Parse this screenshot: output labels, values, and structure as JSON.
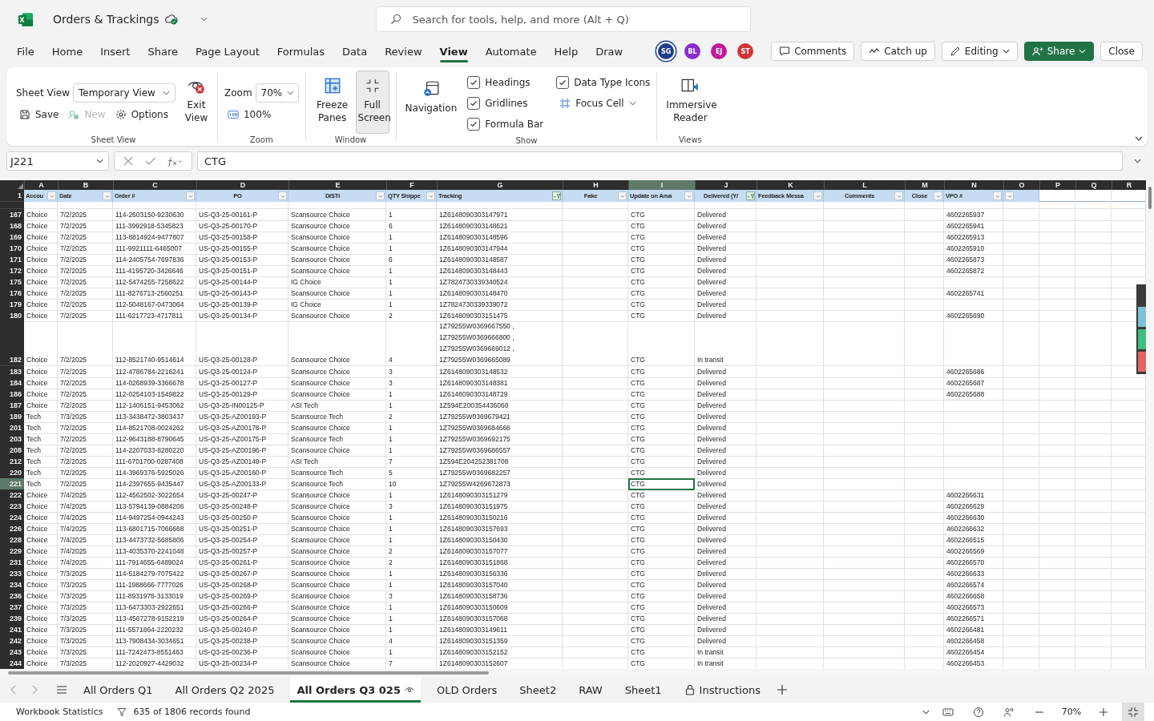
{
  "app": {
    "title": "Orders & Trackings",
    "search": {
      "placeholder": "Search for tools, help, and more (Alt + Q)"
    }
  },
  "menu": [
    {
      "label": "File",
      "selected": false
    },
    {
      "label": "Home",
      "selected": false
    },
    {
      "label": "Insert",
      "selected": false
    },
    {
      "label": "Share",
      "selected": false
    },
    {
      "label": "Page Layout",
      "selected": false
    },
    {
      "label": "Formulas",
      "selected": false
    },
    {
      "label": "Data",
      "selected": false
    },
    {
      "label": "Review",
      "selected": false
    },
    {
      "label": "View",
      "selected": true
    },
    {
      "label": "Automate",
      "selected": false
    },
    {
      "label": "Help",
      "selected": false
    },
    {
      "label": "Draw",
      "selected": false
    }
  ],
  "collaborators": [
    {
      "initials": "SG",
      "color": "#1f3f8c",
      "selected": true
    },
    {
      "initials": "BL",
      "color": "#8a2bd0",
      "selected": false
    },
    {
      "initials": "EJ",
      "color": "#c2189b",
      "selected": false
    },
    {
      "initials": "ST",
      "color": "#d13438",
      "selected": false
    }
  ],
  "actions": [
    {
      "label": "Comments",
      "kind": "comments"
    },
    {
      "label": "Catch up",
      "kind": "catchup"
    },
    {
      "label": "Editing",
      "kind": "editing"
    },
    {
      "label": "Share",
      "kind": "share"
    },
    {
      "label": "Close",
      "kind": "close"
    }
  ],
  "ribbon": {
    "sheet_view": {
      "label": "Sheet View",
      "dropdown": "Temporary View",
      "exit": "Exit View",
      "save": {
        "label": "Save",
        "disabled": false
      },
      "new": {
        "label": "New",
        "disabled": true
      },
      "options": "Options",
      "group": "Sheet View"
    },
    "zoom": {
      "label": "Zoom",
      "dropdown": "70%",
      "reset": "100%",
      "group": "Zoom"
    },
    "window": {
      "freeze": {
        "label": "Freeze Panes",
        "pressed": false
      },
      "full_screen": {
        "label": "Full Screen",
        "pressed": true
      },
      "group": "Window"
    },
    "show": {
      "navigation": "Navigation",
      "checkboxes": [
        {
          "label": "Headings",
          "checked": true
        },
        {
          "label": "Gridlines",
          "checked": true
        },
        {
          "label": "Formula Bar",
          "checked": true
        },
        {
          "label": "Data Type Icons",
          "checked": true
        }
      ],
      "focus_cell": "Focus Cell",
      "group": "Show"
    },
    "views": {
      "immersive": "Immersive Reader",
      "group": "Views"
    }
  },
  "formula_bar": {
    "name_box": "J221",
    "formula": "CTG"
  },
  "columns": [
    {
      "letter": "A",
      "header": "Accou",
      "filter": true,
      "filtered": false,
      "selected": false
    },
    {
      "letter": "B",
      "header": "Date",
      "filter": true,
      "filtered": false,
      "selected": false
    },
    {
      "letter": "C",
      "header": "Order #",
      "filter": true,
      "filtered": false,
      "selected": false
    },
    {
      "letter": "D",
      "header": "PO",
      "filter": true,
      "filtered": false,
      "selected": false
    },
    {
      "letter": "E",
      "header": "DISTI",
      "filter": true,
      "filtered": false,
      "selected": false
    },
    {
      "letter": "F",
      "header": "QTY Shippe",
      "filter": true,
      "filtered": false,
      "selected": false
    },
    {
      "letter": "G",
      "header": "Tracking",
      "filter": true,
      "filtered": true,
      "selected": false
    },
    {
      "letter": "H",
      "header": "Fake",
      "filter": true,
      "filtered": false,
      "selected": false
    },
    {
      "letter": "I",
      "header": "Update on Ama",
      "filter": true,
      "filtered": false,
      "selected": true
    },
    {
      "letter": "J",
      "header": "Delivered (Y/",
      "filter": true,
      "filtered": true,
      "selected": false
    },
    {
      "letter": "K",
      "header": "Feedback Messa",
      "filter": true,
      "filtered": false,
      "selected": false
    },
    {
      "letter": "L",
      "header": "Comments",
      "filter": true,
      "filtered": false,
      "selected": false
    },
    {
      "letter": "M",
      "header": "Close",
      "filter": true,
      "filtered": false,
      "selected": false
    },
    {
      "letter": "N",
      "header": "VPO #",
      "filter": true,
      "filtered": false,
      "selected": false
    },
    {
      "letter": "O",
      "filter": true,
      "filtered": false,
      "selected": false
    },
    {
      "letter": "P",
      "filter": false,
      "selected": false
    },
    {
      "letter": "Q",
      "filter": false,
      "selected": false
    },
    {
      "letter": "R",
      "filter": false,
      "selected": false
    }
  ],
  "header_row": "1",
  "rows": [
    {
      "row": "167",
      "selected": false,
      "account": "Choice",
      "date": "7/2/2025",
      "order": "114-2603150-9230630",
      "po": "US-Q3-25-00161-P",
      "disti": "Scansource Choice",
      "qty": "1",
      "tracking": "1Z6148090303147971",
      "update": "CTG",
      "delivered": "Delivered",
      "vpo": "4602265937"
    },
    {
      "row": "168",
      "selected": false,
      "account": "Choice",
      "date": "7/2/2025",
      "order": "111-3992918-5345823",
      "po": "US-Q3-25-00170-P",
      "disti": "Scansource Choice",
      "qty": "6",
      "tracking": "1Z6148090303148621",
      "update": "CTG",
      "delivered": "Delivered",
      "vpo": "4602265941"
    },
    {
      "row": "169",
      "selected": false,
      "account": "Choice",
      "date": "7/2/2025",
      "order": "113-8814924-9477807",
      "po": "US-Q3-25-00158-P",
      "disti": "Scansource Choice",
      "qty": "1",
      "tracking": "1Z6148090303148596",
      "update": "CTG",
      "delivered": "Delivered",
      "vpo": "4602265913"
    },
    {
      "row": "170",
      "selected": false,
      "account": "Choice",
      "date": "7/2/2025",
      "order": "111-9921111-6465007",
      "po": "US-Q3-25-00155-P",
      "disti": "Scansource Choice",
      "qty": "1",
      "tracking": "1Z6148090303147944",
      "update": "CTG",
      "delivered": "Delivered",
      "vpo": "4602265910"
    },
    {
      "row": "171",
      "selected": false,
      "account": "Choice",
      "date": "7/2/2025",
      "order": "114-2405754-7697836",
      "po": "US-Q3-25-00153-P",
      "disti": "Scansource Choice",
      "qty": "6",
      "tracking": "1Z6148090303148587",
      "update": "CTG",
      "delivered": "Delivered",
      "vpo": "4602265873"
    },
    {
      "row": "172",
      "selected": false,
      "account": "Choice",
      "date": "7/2/2025",
      "order": "111-4195720-3426646",
      "po": "US-Q3-25-00151-P",
      "disti": "Scansource Choice",
      "qty": "1",
      "tracking": "1Z6148090303148443",
      "update": "CTG",
      "delivered": "Delivered",
      "vpo": "4602265872"
    },
    {
      "row": "175",
      "selected": false,
      "account": "Choice",
      "date": "7/2/2025",
      "order": "112-5474255-7258622",
      "po": "US-Q3-25-00144-P",
      "disti": "IG Choice",
      "qty": "1",
      "tracking": "1Z7824730339340524",
      "update": "CTG",
      "delivered": "Delivered"
    },
    {
      "row": "176",
      "selected": false,
      "account": "Choice",
      "date": "7/2/2025",
      "order": "111-8276713-2560251",
      "po": "US-Q3-25-00143-P",
      "disti": "Scansource Choice",
      "qty": "1",
      "tracking": "1Z6148090303148470",
      "update": "CTG",
      "delivered": "Delivered",
      "vpo": "4602265741"
    },
    {
      "row": "179",
      "selected": false,
      "account": "Choice",
      "date": "7/2/2025",
      "order": "112-5048167-0473064",
      "po": "US-Q3-25-00139-P",
      "disti": "IG Choice",
      "qty": "1",
      "tracking": "1Z7824730339339072",
      "update": "CTG",
      "delivered": "Delivered"
    },
    {
      "row": "180",
      "selected": false,
      "account": "Choice",
      "date": "7/2/2025",
      "order": "111-6217723-4717811",
      "po": "US-Q3-25-00134-P",
      "disti": "Scansource Choice",
      "qty": "2",
      "tracking": "1Z6148090303151475",
      "update": "CTG",
      "delivered": "Delivered",
      "vpo": "4602265690"
    },
    {
      "row": "182",
      "selected": false,
      "account": "Choice",
      "date": "7/2/2025",
      "order": "112-8521740-9514614",
      "po": "US-Q3-25-00128-P",
      "disti": "Scansource Choice",
      "qty": "4",
      "tracking": "1Z79255W0369667550 ,\n1Z79255W0369666800 ,\n1Z79255W0369669012 ,\n1Z79255W0369665089",
      "update": "CTG",
      "delivered": "In transit"
    },
    {
      "row": "183",
      "selected": false,
      "account": "Choice",
      "date": "7/2/2025",
      "order": "112-4786784-2216241",
      "po": "US-Q3-25-00124-P",
      "disti": "Scansource Choice",
      "qty": "3",
      "tracking": "1Z6148090303148532",
      "update": "CTG",
      "delivered": "Delivered",
      "vpo": "4602265686"
    },
    {
      "row": "184",
      "selected": false,
      "account": "Choice",
      "date": "7/2/2025",
      "order": "114-0268939-3366678",
      "po": "US-Q3-25-00127-P",
      "disti": "Scansource Choice",
      "qty": "3",
      "tracking": "1Z6148090303148381",
      "update": "CTG",
      "delivered": "Delivered",
      "vpo": "4602265687"
    },
    {
      "row": "186",
      "selected": false,
      "account": "Choice",
      "date": "7/2/2025",
      "order": "112-0254103-1549822",
      "po": "US-Q3-25-00129-P",
      "disti": "Scansource Choice",
      "qty": "1",
      "tracking": "1Z6148090303148729",
      "update": "CTG",
      "delivered": "Delivered",
      "vpo": "4602265688"
    },
    {
      "row": "187",
      "selected": false,
      "account": "Choice",
      "date": "7/2/2025",
      "order": "112-1406151-9453062",
      "po": "US-Q3-25-IN00125-P",
      "disti": "ASI Tech",
      "qty": "1",
      "tracking": "1Z594E200354436068",
      "update": "CTG",
      "delivered": "Delivered"
    },
    {
      "row": "189",
      "selected": false,
      "account": "Tech",
      "date": "7/3/2025",
      "order": "113-3438472-3803437",
      "po": "US-Q3-25-AZ00193-P",
      "disti": "Scansource Tech",
      "qty": "2",
      "tracking": "1Z79255W0369679421",
      "update": "CTG",
      "delivered": "Delivered"
    },
    {
      "row": "201",
      "selected": false,
      "account": "Tech",
      "date": "7/2/2025",
      "order": "114-8521708-0024262",
      "po": "US-Q3-25-AZ00178-P",
      "disti": "Scansource Choice",
      "qty": "1",
      "tracking": "1Z79255W0369684666",
      "update": "CTG",
      "delivered": "Delivered"
    },
    {
      "row": "203",
      "selected": false,
      "account": "Tech",
      "date": "7/2/2025",
      "order": "112-9643188-8790645",
      "po": "US-Q3-25-AZ00175-P",
      "disti": "Scansource Tech",
      "qty": "1",
      "tracking": "1Z79255W0369692175",
      "update": "CTG",
      "delivered": "Delivered"
    },
    {
      "row": "208",
      "selected": false,
      "account": "Tech",
      "date": "7/2/2025",
      "order": "114-2207033-8280220",
      "po": "US-Q3-25-AZ00196-P",
      "disti": "Scansource Choice",
      "qty": "1",
      "tracking": "1Z79255W0369686557",
      "update": "CTG",
      "delivered": "Delivered"
    },
    {
      "row": "212",
      "selected": false,
      "account": "Tech",
      "date": "7/2/2025",
      "order": "111-6701700-0287408",
      "po": "US-Q3-25-AZ00149-P",
      "disti": "ASI Tech",
      "qty": "7",
      "tracking": "1Z594E204252381708",
      "update": "CTG",
      "delivered": "Delivered"
    },
    {
      "row": "220",
      "selected": false,
      "account": "Tech",
      "date": "7/2/2025",
      "order": "114-3969376-5925026",
      "po": "US-Q3-25-AZ00160-P",
      "disti": "Scansource Tech",
      "qty": "5",
      "tracking": "1Z79255W0369682257",
      "update": "CTG",
      "delivered": "Delivered"
    },
    {
      "row": "221",
      "selected": true,
      "account": "Tech",
      "date": "7/2/2025",
      "order": "114-2397655-9435447",
      "po": "US-Q3-25-AZ00133-P",
      "disti": "Scansource Tech",
      "qty": "10",
      "tracking": "1Z79255W4269672873",
      "update": "CTG",
      "delivered": "Delivered"
    },
    {
      "row": "222",
      "selected": false,
      "account": "Choice",
      "date": "7/4/2025",
      "order": "112-4562502-3022654",
      "po": "US-Q3-25-00247-P",
      "disti": "Scansource Choice",
      "qty": "1",
      "tracking": "1Z6148090303151279",
      "update": "CTG",
      "delivered": "Delivered",
      "vpo": "4602266631"
    },
    {
      "row": "223",
      "selected": false,
      "account": "Choice",
      "date": "7/4/2025",
      "order": "113-5794139-0884206",
      "po": "US-Q3-25-00248-P",
      "disti": "Scansource Choice",
      "qty": "3",
      "tracking": "1Z6148090303151975",
      "update": "CTG",
      "delivered": "Delivered",
      "vpo": "4602266629"
    },
    {
      "row": "224",
      "selected": false,
      "account": "Choice",
      "date": "7/4/2025",
      "order": "114-9497254-0944243",
      "po": "US-Q3-25-00250-P",
      "disti": "Scansource Choice",
      "qty": "1",
      "tracking": "1Z6148090303150216",
      "update": "CTG",
      "delivered": "Delivered",
      "vpo": "4602266630"
    },
    {
      "row": "226",
      "selected": false,
      "account": "Choice",
      "date": "7/4/2025",
      "order": "113-6801715-7066668",
      "po": "US-Q3-25-00251-P",
      "disti": "Scansource Choice",
      "qty": "1",
      "tracking": "1Z6148090303157693",
      "update": "CTG",
      "delivered": "Delivered",
      "vpo": "4602266632"
    },
    {
      "row": "228",
      "selected": false,
      "account": "Choice",
      "date": "7/4/2025",
      "order": "113-4473732-5685806",
      "po": "US-Q3-25-00254-P",
      "disti": "Scansource Choice",
      "qty": "1",
      "tracking": "1Z6148090303150430",
      "update": "CTG",
      "delivered": "Delivered",
      "vpo": "4602266515"
    },
    {
      "row": "229",
      "selected": false,
      "account": "Choice",
      "date": "7/4/2025",
      "order": "113-4035370-2241048",
      "po": "US-Q3-25-00257-P",
      "disti": "Scansource Choice",
      "qty": "2",
      "tracking": "1Z6148090303157077",
      "update": "CTG",
      "delivered": "Delivered",
      "vpo": "4602266569"
    },
    {
      "row": "231",
      "selected": false,
      "account": "Choice",
      "date": "7/4/2025",
      "order": "111-7914655-6489024",
      "po": "US-Q3-25-00261-P",
      "disti": "Scansource Choice",
      "qty": "2",
      "tracking": "1Z6148090303151868",
      "update": "CTG",
      "delivered": "Delivered",
      "vpo": "4602266570"
    },
    {
      "row": "233",
      "selected": false,
      "account": "Choice",
      "date": "7/3/2025",
      "order": "114-5184279-7075422",
      "po": "US-Q3-25-00267-P",
      "disti": "Scansource Choice",
      "qty": "1",
      "tracking": "1Z6148090303156336",
      "update": "CTG",
      "delivered": "Delivered",
      "vpo": "4602266633"
    },
    {
      "row": "234",
      "selected": false,
      "account": "Choice",
      "date": "7/3/2025",
      "order": "111-1988666-7777026",
      "po": "US-Q3-25-00268-P",
      "disti": "Scansource Choice",
      "qty": "1",
      "tracking": "1Z6148090303157040",
      "update": "CTG",
      "delivered": "Delivered",
      "vpo": "4602266574"
    },
    {
      "row": "236",
      "selected": false,
      "account": "Choice",
      "date": "7/3/2025",
      "order": "111-8931976-3133019",
      "po": "US-Q3-25-00269-P",
      "disti": "Scansource Choice",
      "qty": "3",
      "tracking": "1Z6148090303158736",
      "update": "CTG",
      "delivered": "Delivered",
      "vpo": "4602266658"
    },
    {
      "row": "237",
      "selected": false,
      "account": "Choice",
      "date": "7/3/2025",
      "order": "113-6473303-2922651",
      "po": "US-Q3-25-00266-P",
      "disti": "Scansource Choice",
      "qty": "1",
      "tracking": "1Z6148090303150609",
      "update": "CTG",
      "delivered": "Delivered",
      "vpo": "4602266573"
    },
    {
      "row": "239",
      "selected": false,
      "account": "Choice",
      "date": "7/3/2025",
      "order": "113-4567278-9152219",
      "po": "US-Q3-25-00264-P",
      "disti": "Scansource Choice",
      "qty": "1",
      "tracking": "1Z6148090303157068",
      "update": "CTG",
      "delivered": "Delivered",
      "vpo": "4602266571"
    },
    {
      "row": "241",
      "selected": false,
      "account": "Choice",
      "date": "7/3/2025",
      "order": "111-5571864-2220232",
      "po": "US-Q3-25-00240-P",
      "disti": "Scansource Choice",
      "qty": "1",
      "tracking": "1Z6148090303149611",
      "update": "CTG",
      "delivered": "Delivered",
      "vpo": "4602266481"
    },
    {
      "row": "242",
      "selected": false,
      "account": "Choice",
      "date": "7/3/2025",
      "order": "113-7908434-3034651",
      "po": "US-Q3-25-00238-P",
      "disti": "Scansource Choice",
      "qty": "4",
      "tracking": "1Z6148090303151359",
      "update": "CTG",
      "delivered": "Delivered",
      "vpo": "4602266458"
    },
    {
      "row": "243",
      "selected": false,
      "account": "Choice",
      "date": "7/3/2025",
      "order": "111-7242473-8551463",
      "po": "US-Q3-25-00236-P",
      "disti": "Scansource Choice",
      "qty": "1",
      "tracking": "1Z6148090303152152",
      "update": "CTG",
      "delivered": "In transit",
      "vpo": "4602266454"
    },
    {
      "row": "244",
      "selected": false,
      "account": "Choice",
      "date": "7/3/2025",
      "order": "112-2020927-4429032",
      "po": "US-Q3-25-00234-P",
      "disti": "Scansource Choice",
      "qty": "7",
      "tracking": "1Z6148090303152607",
      "update": "CTG",
      "delivered": "In transit",
      "vpo": "4602266453"
    }
  ],
  "sheet_tabs": [
    {
      "label": "All Orders Q1",
      "selected": false,
      "kind": "plain"
    },
    {
      "label": "All Orders Q2 2025",
      "selected": false,
      "kind": "plain"
    },
    {
      "label": "All Orders Q3 025",
      "selected": true,
      "kind": "view"
    },
    {
      "label": "OLD Orders",
      "selected": false,
      "kind": "plain"
    },
    {
      "label": "Sheet2",
      "selected": false,
      "kind": "plain"
    },
    {
      "label": "RAW",
      "selected": false,
      "kind": "plain"
    },
    {
      "label": "Sheet1",
      "selected": false,
      "kind": "plain"
    },
    {
      "label": "Instructions",
      "selected": false,
      "kind": "locked"
    }
  ],
  "status_bar": {
    "statistics": "Workbook Statistics",
    "records": "635 of 1806 records found",
    "zoom": "70%"
  }
}
